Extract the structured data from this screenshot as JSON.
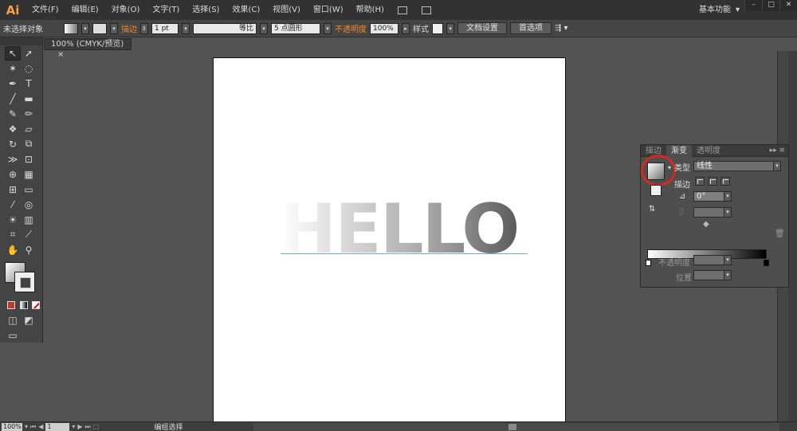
{
  "app": {
    "logo": "Ai",
    "workspace": "基本功能"
  },
  "menu": [
    "文件(F)",
    "编辑(E)",
    "对象(O)",
    "文字(T)",
    "选择(S)",
    "效果(C)",
    "视图(V)",
    "窗口(W)",
    "帮助(H)"
  ],
  "control": {
    "selection": "未选择对象",
    "stroke_label": "描边",
    "stroke_weight": "1 pt",
    "profile": "等比",
    "brush": "5 点圆形",
    "opacity_label": "不透明度",
    "opacity_value": "100%",
    "style_label": "样式",
    "doc_setup": "文档设置",
    "preferences": "首选项"
  },
  "document": {
    "tab_label": "100% (CMYK/预览)",
    "close": "×"
  },
  "artboard": {
    "text": "HELLO"
  },
  "gradient_panel": {
    "tabs": [
      "描边",
      "渐变",
      "透明度"
    ],
    "active_tab": 1,
    "type_label": "类型",
    "type_value": "线性",
    "stroke_label": "描边",
    "angle_value": "0°",
    "opacity_label": "不透明度",
    "position_label": "位置",
    "colors": {
      "start": "#ffffff",
      "end": "#000000"
    }
  },
  "status": {
    "zoom": "100%",
    "page": "1",
    "tool_text": "编组选择"
  },
  "colors": {
    "accent_orange": "#f7a43b",
    "highlight_circle": "#d42a1e"
  }
}
